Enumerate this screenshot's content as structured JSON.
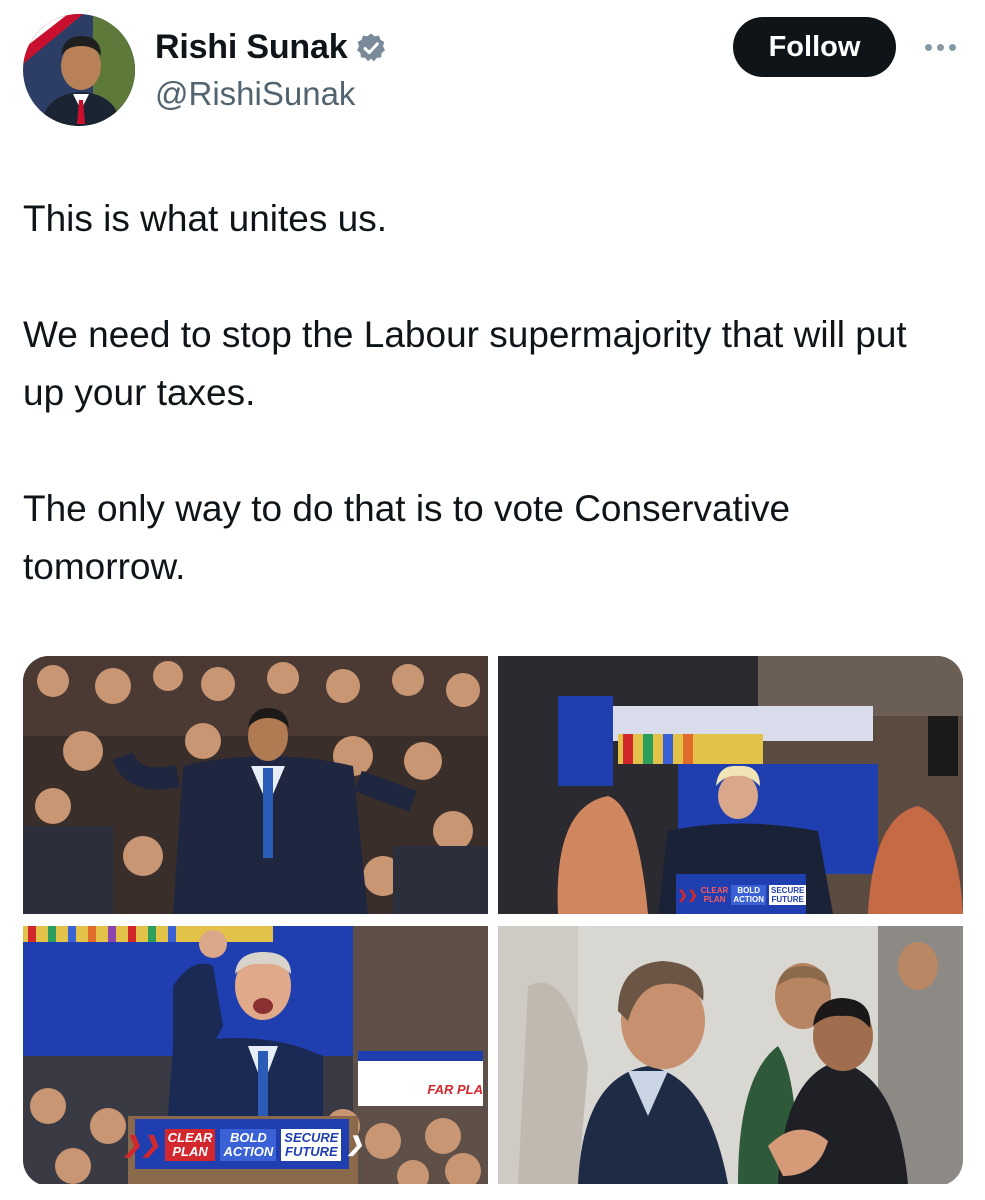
{
  "author": {
    "name": "Rishi Sunak",
    "handle": "@RishiSunak",
    "verified": true,
    "verified_icon": "verified-badge-icon"
  },
  "actions": {
    "follow_label": "Follow",
    "more_icon": "more-options-icon"
  },
  "tweet": {
    "paragraphs": [
      "This is what unites us.",
      "We need to stop the Labour supermajority that will put up your taxes.",
      "The only way to do that is to vote Conservative tomorrow."
    ]
  },
  "media": {
    "photos": [
      {
        "description": "crowd cheering"
      },
      {
        "description": "speaker at podium"
      },
      {
        "description": "speaker fist raised"
      },
      {
        "description": "man applauding"
      }
    ],
    "podium_sign": {
      "clear": "CLEAR",
      "plan": "PLAN",
      "bold": "BOLD",
      "action": "ACTION",
      "secure": "SECURE",
      "future": "FUTURE"
    },
    "screen_text": "FAR PLA"
  },
  "colors": {
    "follow_bg": "#0f1419",
    "verified": "#7a8a99",
    "handle": "#536471",
    "brand_blue": "#1f3fb0",
    "brand_red": "#d3272e"
  }
}
